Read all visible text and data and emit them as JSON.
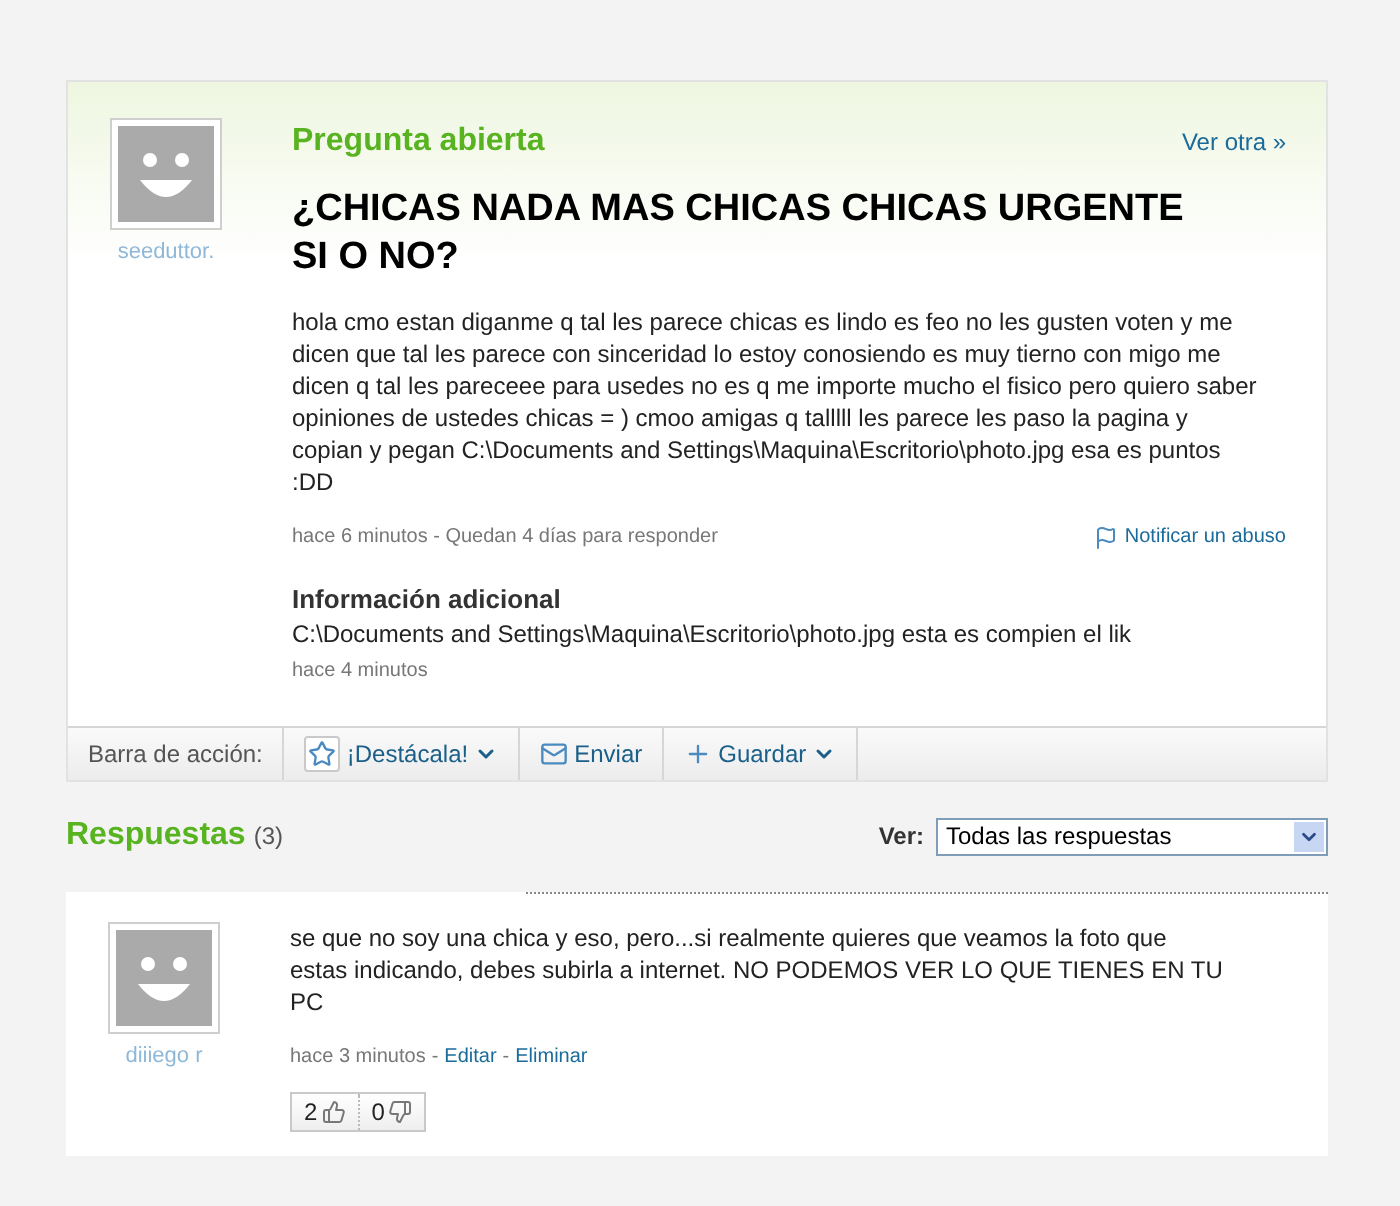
{
  "question": {
    "author": "seeduttor.",
    "status": "Pregunta abierta",
    "next_link": "Ver otra »",
    "title": "¿CHICAS NADA MAS CHICAS CHICAS URGENTE SI O NO?",
    "body": "hola cmo estan diganme q tal les parece chicas es lindo es feo no les gusten voten y me dicen que tal les parece con sinceridad lo estoy conosiendo es muy tierno con migo me dicen q tal les pareceee para usedes no es q me importe mucho el fisico pero quiero saber opiniones de ustedes chicas = ) cmoo amigas q talllll les parece les paso la pagina y copian y pegan C:\\Documents and Settings\\Maquina\\Escritorio\\photo.jpg esa es puntos :DD",
    "meta": "hace 6 minutos - Quedan 4 días para responder",
    "report_link": "Notificar un abuso",
    "additional": {
      "heading": "Información adicional",
      "text": "C:\\Documents and Settings\\Maquina\\Escritorio\\photo.jpg esta es compien el lik",
      "time": "hace 4 minutos"
    }
  },
  "action_bar": {
    "label": "Barra de acción:",
    "actions": [
      {
        "kind": "star",
        "label": "¡Destácala!",
        "dropdown": true
      },
      {
        "kind": "mail",
        "label": "Enviar",
        "dropdown": false
      },
      {
        "kind": "plus",
        "label": "Guardar",
        "dropdown": true
      }
    ]
  },
  "answers_header": {
    "title": "Respuestas",
    "count": "(3)",
    "filter_label": "Ver:",
    "filter_value": "Todas las respuestas"
  },
  "answers": [
    {
      "author": "diiiego r",
      "text": "se que no soy una chica y eso, pero...si realmente quieres que veamos la foto que estas indicando, debes subirla a internet. NO PODEMOS VER LO QUE TIENES EN TU PC",
      "time": "hace 3 minutos",
      "separator": "-",
      "links": [
        "Editar",
        "Eliminar"
      ],
      "thumbs_up": "2",
      "thumbs_down": "0"
    }
  ]
}
